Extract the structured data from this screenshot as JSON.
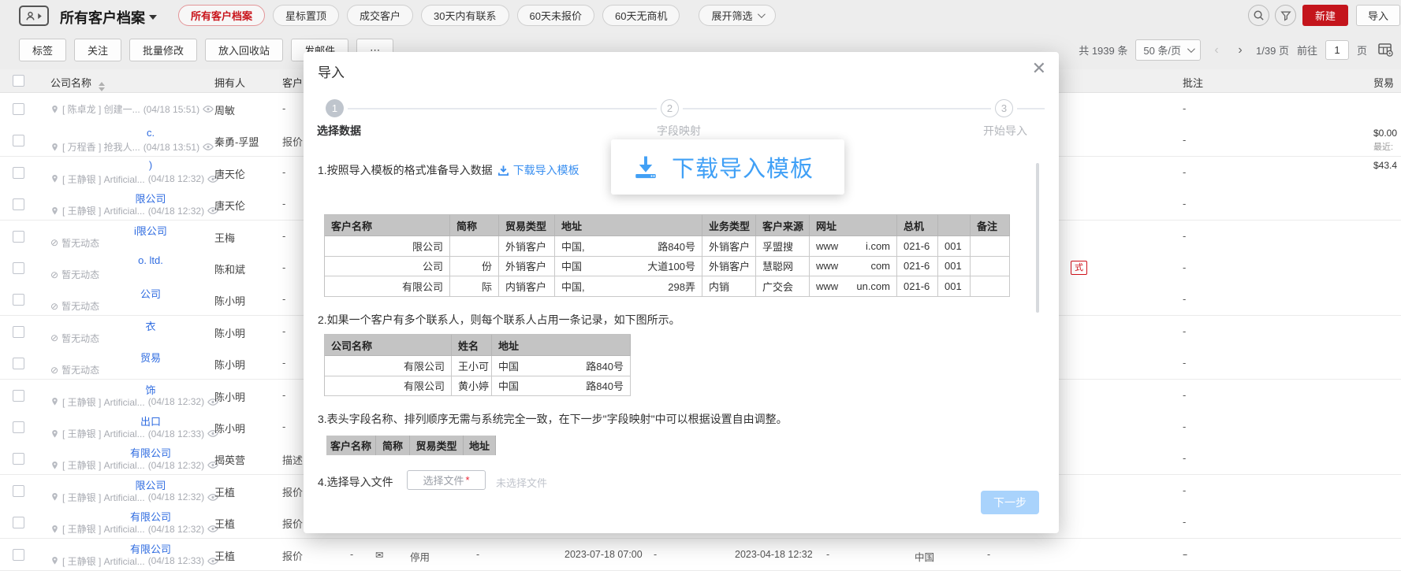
{
  "colors": {
    "accent_red": "#c4151c",
    "link_blue": "#2e6be0",
    "primary_blue": "#3a8ff0",
    "disabled_blue": "#a9d3fc",
    "step_done_gray": "#bfc5cd"
  },
  "topbar": {
    "title": "所有客户档案",
    "filters": [
      {
        "label": "所有客户档案",
        "active": true
      },
      {
        "label": "星标置顶",
        "active": false
      },
      {
        "label": "成交客户",
        "active": false
      },
      {
        "label": "30天内有联系",
        "active": false
      },
      {
        "label": "60天未报价",
        "active": false
      },
      {
        "label": "60天无商机",
        "active": false
      }
    ],
    "expand_filter": "展开筛选",
    "new_button": "新建",
    "import_button": "导入"
  },
  "toolbar": {
    "buttons": [
      "标签",
      "关注",
      "批量修改",
      "放入回收站",
      "发邮件",
      "⋯"
    ],
    "total": "共 1939 条",
    "page_size": "50 条/页",
    "page_indicator": "1/39 页",
    "goto_label": "前往",
    "goto_value": "1",
    "page_label": "页"
  },
  "table": {
    "headers": {
      "company": "公司名称",
      "owner": "拥有人",
      "stage": "客户阶段",
      "notes": "批注",
      "trade": "贸易"
    },
    "rows": [
      {
        "name": "",
        "sub": "[ 陈卓龙 ] 创建一...",
        "time": "(04/18 15:51)",
        "owner": "周敏",
        "stage": "-",
        "note": "-"
      },
      {
        "name": "c.",
        "sub": "[ 万程香 ] 抢我人...",
        "time": "(04/18 13:51)",
        "owner": "秦勇-孚盟",
        "stage": "报价",
        "note": "-",
        "right": "$0.00",
        "right_sub": "最近:"
      },
      {
        "name": ")",
        "sub": "[ 王静银 ] Artificial...",
        "time": "(04/18 12:32)",
        "owner": "唐天伦",
        "stage": "-",
        "note": "-",
        "right": "$43.4"
      },
      {
        "name": "限公司",
        "sub": "[ 王静银 ] Artificial...",
        "time": "(04/18 12:32)",
        "owner": "唐天伦",
        "stage": "-",
        "note": "-"
      },
      {
        "name": "i限公司",
        "sub": "暂无动态",
        "owner": "王梅",
        "stage": "-",
        "note": "-"
      },
      {
        "name": "o. ltd.",
        "sub": "暂无动态",
        "owner": "陈和斌",
        "stage": "-",
        "note": "-",
        "tag": "式"
      },
      {
        "name": "公司",
        "sub": "暂无动态",
        "owner": "陈小明",
        "stage": "-",
        "note": "-"
      },
      {
        "name": "衣",
        "sub": "暂无动态",
        "owner": "陈小明",
        "stage": "-",
        "note": "-"
      },
      {
        "name": "贸易",
        "sub": "暂无动态",
        "owner": "陈小明",
        "stage": "-",
        "note": "-"
      },
      {
        "name": "饰",
        "sub": "[ 王静银 ] Artificial...",
        "time": "(04/18 12:32)",
        "owner": "陈小明",
        "stage": "-",
        "note": "-"
      },
      {
        "name": "出口",
        "sub": "[ 王静银 ] Artificial...",
        "time": "(04/18 12:33)",
        "owner": "陈小明",
        "stage": "-",
        "note": "-"
      },
      {
        "name": "有限公司",
        "sub": "[ 王静银 ] Artificial...",
        "time": "(04/18 12:32)",
        "owner": "揭英营",
        "stage": "描述",
        "note": "-"
      },
      {
        "name": "限公司",
        "sub": "[ 王静银 ] Artificial...",
        "time": "(04/18 12:32)",
        "owner": "王植",
        "stage": "报价",
        "note": "-"
      },
      {
        "name": "有限公司",
        "sub": "[ 王静银 ] Artificial...",
        "time": "(04/18 12:32)",
        "owner": "王植",
        "stage": "报价",
        "note": "-"
      },
      {
        "name": "有限公司",
        "sub": "[ 王静银 ] Artificial...",
        "time": "(04/18 12:33)",
        "owner": "王植",
        "stage": "报价",
        "note": "-"
      }
    ],
    "bottom_row": {
      "values": [
        "-",
        "✉",
        "停用",
        "-",
        "2023-07-18 07:00",
        "-",
        "2023-04-18 12:32",
        "-",
        "中国",
        "-",
        "-"
      ],
      "xs": [
        444,
        476,
        520,
        604,
        716,
        829,
        932,
        1048,
        1160,
        1252,
        1502
      ]
    }
  },
  "modal": {
    "title": "导入",
    "steps": [
      {
        "num": "1",
        "label": "选择数据",
        "state": "done"
      },
      {
        "num": "2",
        "label": "字段映射",
        "state": "todo"
      },
      {
        "num": "3",
        "label": "开始导入",
        "state": "todo"
      }
    ],
    "instruction1": "1.按照导入模板的格式准备导入数据",
    "download_link": "下载导入模板",
    "tooltip_text": "下载导入模板",
    "sample_table1": {
      "headers": [
        "客户名称",
        "简称",
        "贸易类型",
        "地址",
        "业务类型",
        "客户来源",
        "网址",
        "总机",
        "",
        "备注"
      ],
      "widths": [
        159,
        62,
        71,
        187,
        68,
        68,
        111,
        52,
        41,
        50
      ],
      "rows": [
        [
          [
            "",
            "限公司"
          ],
          [
            "",
            ""
          ],
          [
            "外销客户",
            ""
          ],
          [
            "中国,",
            "路840号"
          ],
          [
            "外销客户",
            ""
          ],
          [
            "孚盟搜",
            ""
          ],
          [
            "www",
            "i.com"
          ],
          [
            "021-6",
            ""
          ],
          [
            "001",
            ""
          ],
          [
            "",
            ""
          ]
        ],
        [
          [
            "",
            "公司"
          ],
          [
            "",
            "份"
          ],
          [
            "外销客户",
            ""
          ],
          [
            "中国",
            "大道100号"
          ],
          [
            "外销客户",
            ""
          ],
          [
            "慧聪网",
            ""
          ],
          [
            "www",
            "com"
          ],
          [
            "021-6",
            ""
          ],
          [
            "001",
            ""
          ],
          [
            "",
            ""
          ]
        ],
        [
          [
            "",
            "有限公司"
          ],
          [
            "",
            "际"
          ],
          [
            "内销客户",
            ""
          ],
          [
            "中国,",
            "298弄"
          ],
          [
            "内销",
            ""
          ],
          [
            "广交会",
            ""
          ],
          [
            "www",
            "un.com"
          ],
          [
            "021-6",
            ""
          ],
          [
            "001",
            ""
          ],
          [
            "",
            ""
          ]
        ]
      ]
    },
    "instruction2": "2.如果一个客户有多个联系人，则每个联系人占用一条记录，如下图所示。",
    "sample_table2": {
      "headers": [
        "公司名称",
        "姓名",
        "地址"
      ],
      "widths": [
        161,
        51,
        176
      ],
      "rows": [
        [
          [
            "",
            "有限公司"
          ],
          [
            "王小可",
            ""
          ],
          [
            "中国",
            "路840号"
          ]
        ],
        [
          [
            "",
            "有限公司"
          ],
          [
            "黄小婷",
            ""
          ],
          [
            "中国",
            "路840号"
          ]
        ]
      ]
    },
    "instruction3": "3.表头字段名称、排列顺序无需与系统完全一致，在下一步\"字段映射\"中可以根据设置自由调整。",
    "header_chips": {
      "labels": [
        "客户名称",
        "简称",
        "贸易类型",
        "地址"
      ],
      "widths": [
        63,
        43,
        68,
        41
      ]
    },
    "instruction4": "4.选择导入文件",
    "file_button": "选择文件",
    "file_required": "*",
    "file_placeholder": "未选择文件",
    "next_button": "下一步"
  }
}
